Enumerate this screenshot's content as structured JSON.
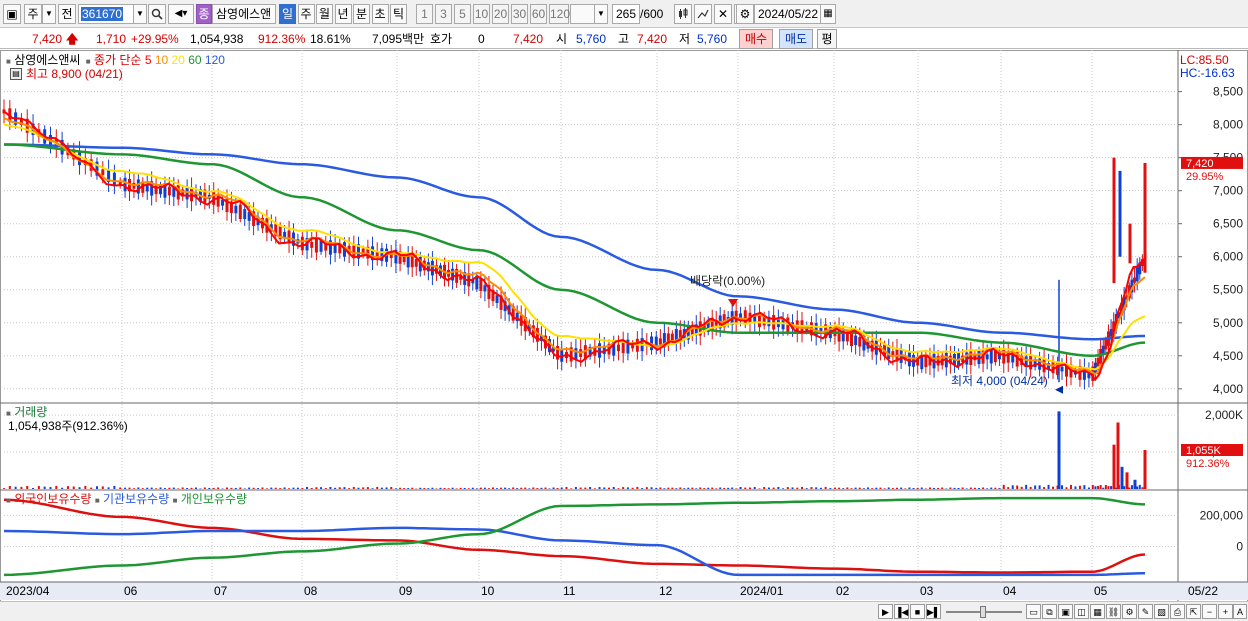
{
  "toolbar": {
    "market_label": "주",
    "prev_label": "전",
    "stock_code": "361670",
    "stock_name_badge": "종",
    "stock_name": "삼영에스앤",
    "periods": [
      "일",
      "주",
      "월",
      "년",
      "분",
      "초",
      "틱"
    ],
    "active_period": "일",
    "intervals": [
      "1",
      "3",
      "5",
      "10",
      "20",
      "30",
      "60",
      "120"
    ],
    "count_display": "265",
    "count_total": "/600",
    "date": "2024/05/22"
  },
  "quote": {
    "price": "7,420",
    "change": "1,710",
    "change_pct": "+29.95%",
    "volume": "1,054,938",
    "volume_ratio": "912.36%",
    "turnover": "18.61%",
    "amount": "7,095백만",
    "hoga_label": "호가",
    "hoga_value": "0",
    "hoga_price": "7,420",
    "open_label": "시",
    "open": "5,760",
    "high_label": "고",
    "high": "7,420",
    "low_label": "저",
    "low": "5,760",
    "buy_label": "매수",
    "sell_label": "매도",
    "extra_label": "평"
  },
  "legend": {
    "price_title": "삼영에스앤씨",
    "ma_title": "종가 단순",
    "ma_periods": [
      "5",
      "10",
      "20",
      "60",
      "120"
    ],
    "high_note": "최고 8,900 (04/21)",
    "low_note": "최저 4,000 (04/24)",
    "dividend_note": "배당락(0.00%)",
    "lc": "LC:85.50",
    "hc": "HC:-16.63",
    "volume_title": "거래량",
    "volume_note": "1,054,938주(912.36%)",
    "holdings_foreign": "외국인보유수량",
    "holdings_inst": "기관보유수량",
    "holdings_indiv": "개인보유수량"
  },
  "price_axis": {
    "ticks": [
      8500,
      8000,
      7500,
      7000,
      6500,
      6000,
      5500,
      5000,
      4500,
      4000
    ],
    "tick_labels": [
      "8,500",
      "8,000",
      "7,500",
      "7,000",
      "6,500",
      "6,000",
      "5,500",
      "5,000",
      "4,500",
      "4,000"
    ],
    "current_label": "7,420",
    "current_pct": "29.95%",
    "current_value": 7420
  },
  "volume_axis": {
    "ticks": [
      2000000,
      1000000
    ],
    "tick_labels": [
      "2,000K",
      "1,000K"
    ],
    "current_label": "1,055K",
    "current_pct": "912.36%",
    "current_value": 1054938
  },
  "holdings_axis": {
    "tick_labels": [
      "200,000",
      "0"
    ]
  },
  "x_axis": {
    "labels": [
      "2023/04",
      "06",
      "07",
      "08",
      "09",
      "10",
      "11",
      "12",
      "2024/01",
      "02",
      "03",
      "04",
      "05",
      "05/22"
    ]
  },
  "colors": {
    "ma5": "#ff0000",
    "ma10": "#ff8c00",
    "ma20": "#ffe000",
    "ma60": "#1e9632",
    "ma120": "#2a5ae0",
    "candle_up": "#e01010",
    "candle_down": "#1040d0",
    "foreign": "#dd1010",
    "inst": "#2a5ae0",
    "indiv": "#1e9632"
  },
  "chart_data": [
    {
      "type": "line",
      "title": "삼영에스앤씨 종가 단순 이동평균",
      "x": [
        "2023/04",
        "06",
        "07",
        "08",
        "09",
        "10",
        "11",
        "12",
        "2024/01",
        "02",
        "03",
        "04",
        "05",
        "05/22"
      ],
      "series": [
        {
          "name": "5",
          "values": [
            8200,
            7100,
            6900,
            6200,
            6000,
            5600,
            4500,
            4700,
            5100,
            4850,
            4400,
            4500,
            4200,
            6000
          ]
        },
        {
          "name": "10",
          "values": [
            8100,
            7150,
            6950,
            6250,
            6000,
            5700,
            4600,
            4700,
            5100,
            4900,
            4450,
            4550,
            4250,
            5700
          ]
        },
        {
          "name": "20",
          "values": [
            8000,
            7300,
            7000,
            6400,
            6050,
            5900,
            4800,
            4650,
            5000,
            4950,
            4550,
            4600,
            4300,
            5100
          ]
        },
        {
          "name": "60",
          "values": [
            7700,
            7550,
            7400,
            6900,
            6400,
            6100,
            5500,
            5000,
            4850,
            4850,
            4850,
            4700,
            4500,
            4700
          ]
        },
        {
          "name": "120",
          "values": [
            7700,
            7650,
            7550,
            7400,
            7200,
            6900,
            6300,
            5800,
            5400,
            5200,
            5000,
            4850,
            4750,
            4800
          ]
        }
      ],
      "ylim": [
        3800,
        9100
      ]
    },
    {
      "type": "bar",
      "title": "거래량",
      "categories": [
        "2023/04",
        "06",
        "07",
        "08",
        "09",
        "10",
        "11",
        "12",
        "2024/01",
        "02",
        "03",
        "04",
        "05",
        "05/22"
      ],
      "values": [
        60000,
        30000,
        30000,
        40000,
        25000,
        30000,
        40000,
        30000,
        40000,
        30000,
        30000,
        2100000,
        1800000,
        1054938
      ],
      "ylim": [
        0,
        2300000
      ]
    },
    {
      "type": "line",
      "title": "보유수량",
      "x": [
        "2023/04",
        "06",
        "07",
        "08",
        "09",
        "10",
        "11",
        "12",
        "2024/01",
        "02",
        "03",
        "04",
        "05",
        "05/22"
      ],
      "series": [
        {
          "name": "외국인보유수량",
          "values": [
            300000,
            190000,
            120000,
            50000,
            40000,
            -20000,
            -60000,
            -110000,
            -120000,
            -140000,
            -160000,
            -165000,
            -160000,
            -50000
          ]
        },
        {
          "name": "기관보유수량",
          "values": [
            100000,
            80000,
            100000,
            100000,
            120000,
            110000,
            40000,
            10000,
            -180000,
            -180000,
            -180000,
            -180000,
            -180000,
            -170000
          ]
        },
        {
          "name": "개인보유수량",
          "values": [
            -180000,
            -120000,
            -70000,
            -30000,
            20000,
            80000,
            260000,
            270000,
            280000,
            290000,
            300000,
            310000,
            310000,
            270000
          ]
        }
      ],
      "ylim": [
        -200000,
        330000
      ]
    }
  ]
}
